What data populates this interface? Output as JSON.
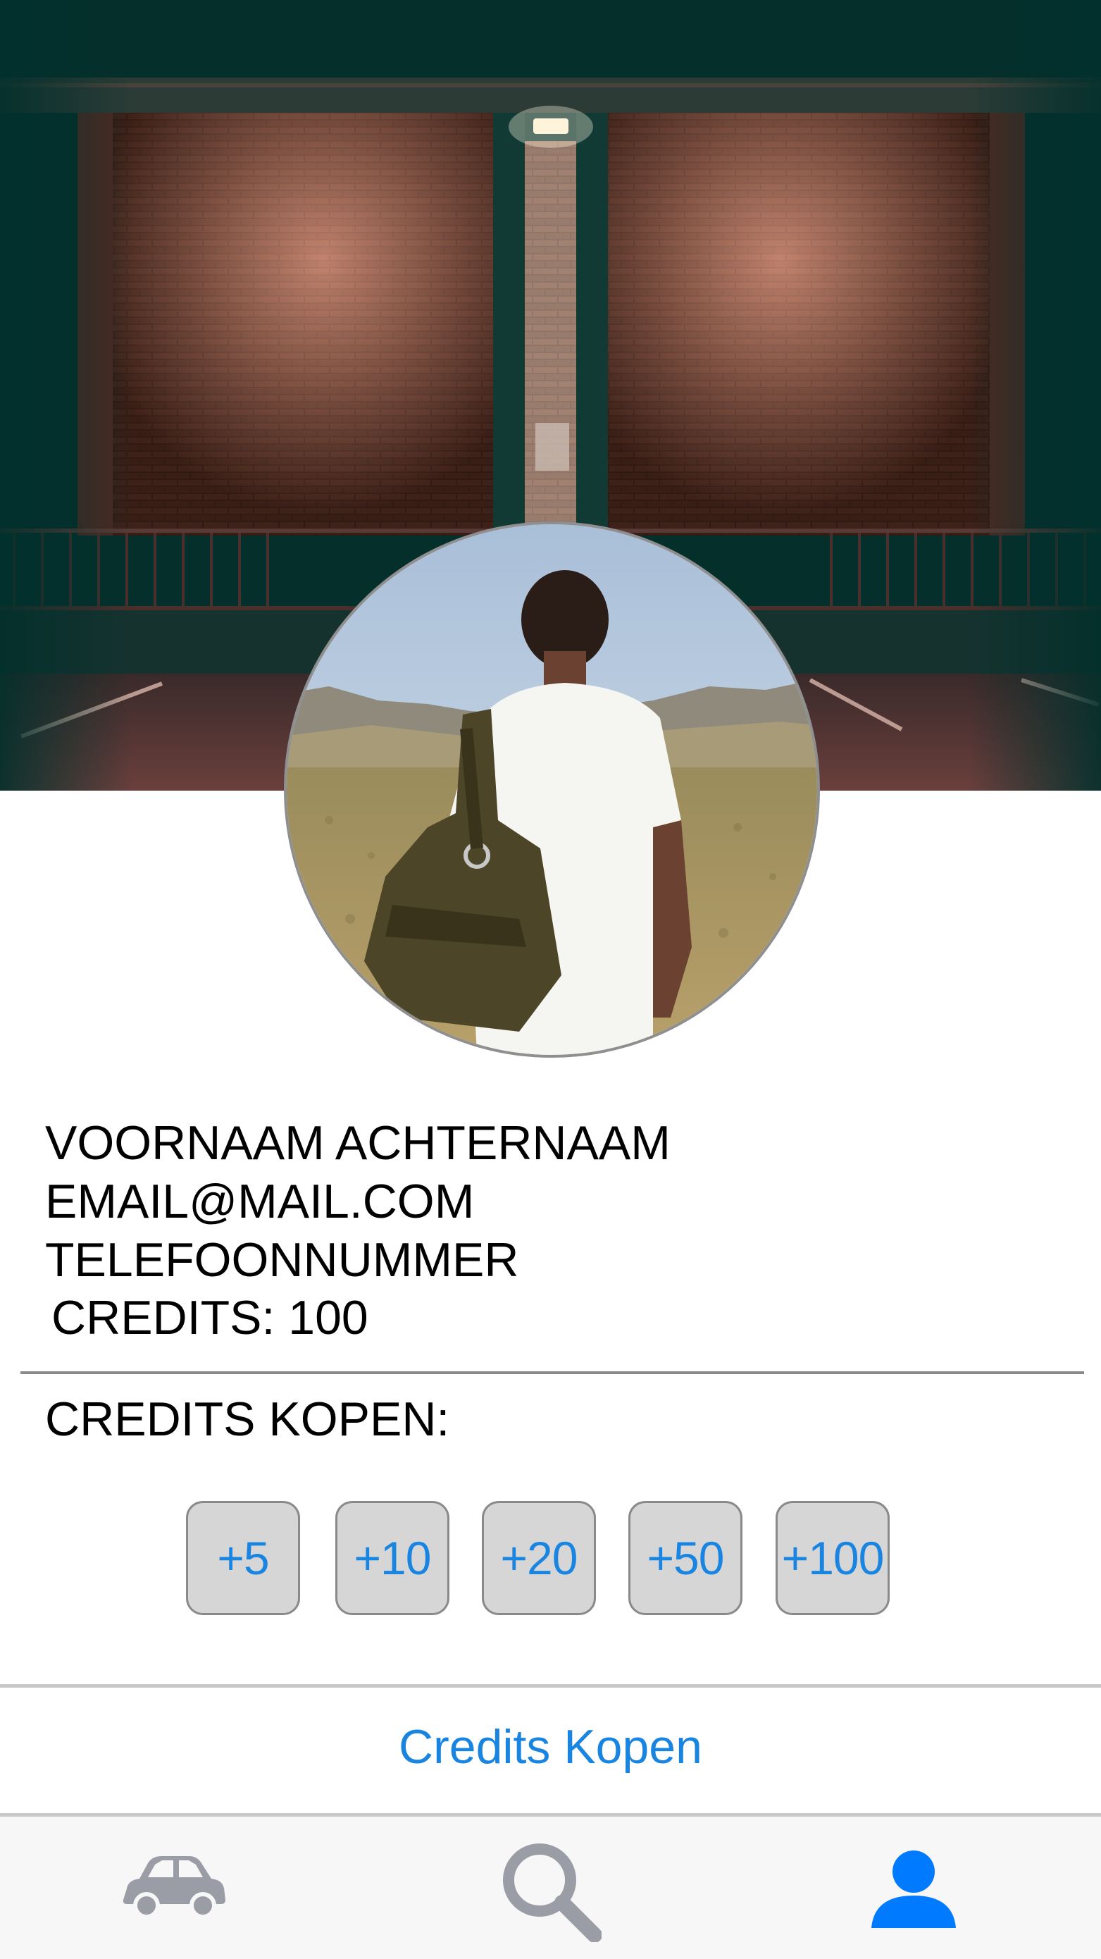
{
  "profile": {
    "name": "VOORNAAM ACHTERNAAM",
    "email": "EMAIL@MAIL.COM",
    "phone": "TELEFOONNUMMER",
    "credits": "CREDITS: 100"
  },
  "buy": {
    "heading": "CREDITS KOPEN:",
    "amounts": [
      "+5",
      "+10",
      "+20",
      "+50",
      "+100"
    ],
    "action_label": "Credits Kopen"
  },
  "tabbar": {
    "tabs": [
      {
        "icon": "car-icon",
        "active": false
      },
      {
        "icon": "search-icon",
        "active": false
      },
      {
        "icon": "person-icon",
        "active": true
      }
    ],
    "active_color": "#007aff",
    "inactive_color": "#9b9da6"
  },
  "colors": {
    "accent": "#1a85e0",
    "button_bg": "#d6d6d6"
  }
}
